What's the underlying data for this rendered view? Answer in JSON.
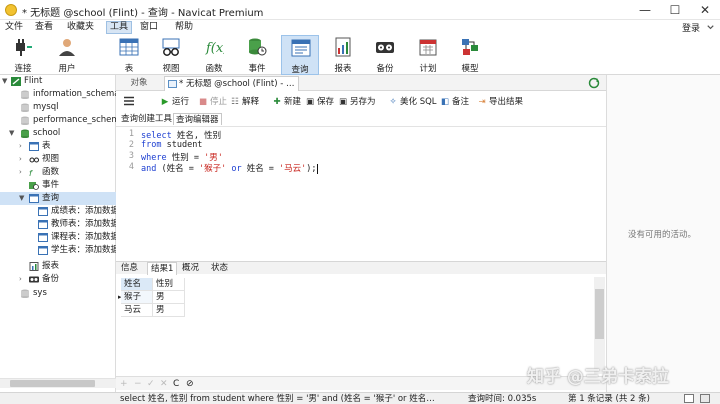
{
  "window": {
    "title": "* 无标题 @school (Flint) - 查询 - Navicat Premium",
    "minimize": "—",
    "maximize": "☐",
    "close": "✕"
  },
  "menu": {
    "items": [
      "文件",
      "查看",
      "收藏夹",
      "工具",
      "窗口",
      "帮助"
    ],
    "active": "工具",
    "login": "登录"
  },
  "toolbar": {
    "items": [
      {
        "label": "连接",
        "icon": "connection-icon"
      },
      {
        "label": "用户",
        "icon": "user-icon"
      },
      {
        "label": "表",
        "icon": "table-icon"
      },
      {
        "label": "视图",
        "icon": "view-icon"
      },
      {
        "label": "函数",
        "icon": "function-icon"
      },
      {
        "label": "事件",
        "icon": "event-icon"
      },
      {
        "label": "查询",
        "icon": "query-icon"
      },
      {
        "label": "报表",
        "icon": "report-icon"
      },
      {
        "label": "备份",
        "icon": "backup-icon"
      },
      {
        "label": "计划",
        "icon": "schedule-icon"
      },
      {
        "label": "模型",
        "icon": "model-icon"
      }
    ],
    "active": "查询"
  },
  "sidebar": {
    "connection": "Flint",
    "databases": [
      "information_schema",
      "mysql",
      "performance_schema"
    ],
    "school": {
      "name": "school",
      "children": [
        "表",
        "视图",
        "函数",
        "事件",
        "查询"
      ],
      "queries": [
        "成绩表：添加数据",
        "教师表：添加数据",
        "课程表：添加数据",
        "学生表：添加数据"
      ],
      "more": [
        "报表",
        "备份"
      ]
    },
    "sys": "sys"
  },
  "tabs": {
    "objects": "对象",
    "query": "* 无标题 @school (Flint) - 查..."
  },
  "editor_toolbar": {
    "run": "运行",
    "stop": "停止",
    "explain": "解释",
    "new": "新建",
    "save": "保存",
    "save_as": "另存为",
    "beautify": "美化 SQL",
    "note": "备注",
    "export": "导出结果"
  },
  "editor_tabs": {
    "builder": "查询创建工具",
    "editor": "查询编辑器"
  },
  "editor": {
    "line_numbers": [
      "1",
      "2",
      "3",
      "4"
    ],
    "l1_kw": "select",
    "l1_rest": " 姓名, 性别",
    "l2_kw": "from",
    "l2_rest": " student",
    "l3_kw": "where",
    "l3_rest": " 性别 = ",
    "l3_str": "'男'",
    "l4_kw": "and",
    "l4_a": " (姓名 = ",
    "l4_s1": "'猴子'",
    "l4_or": " or ",
    "l4_b": "姓名 = ",
    "l4_s2": "'马云'",
    "l4_end": ");"
  },
  "result_tabs": [
    "信息",
    "结果1",
    "概况",
    "状态"
  ],
  "result_active": "结果1",
  "grid": {
    "columns": [
      "姓名",
      "性别"
    ],
    "rows": [
      [
        "猴子",
        "男"
      ],
      [
        "马云",
        "男"
      ]
    ]
  },
  "grid_footer": [
    "+",
    "−",
    "✓",
    "✕",
    "C",
    "⊘"
  ],
  "right_panel": {
    "empty_text": "没有可用的活动。"
  },
  "status": {
    "sql": "select 姓名, 性别  from student where 性别 = '男' and (姓名 = '猴子' or 姓名 : 只读",
    "time": "查询时间: 0.035s",
    "records": "第 1 条记录 (共 2 条)"
  },
  "watermark": "知乎 @三弟卡索拉",
  "colors": {
    "keyword": "#1d3fd1",
    "string": "#c7211a",
    "selection": "#cfe2f6"
  }
}
